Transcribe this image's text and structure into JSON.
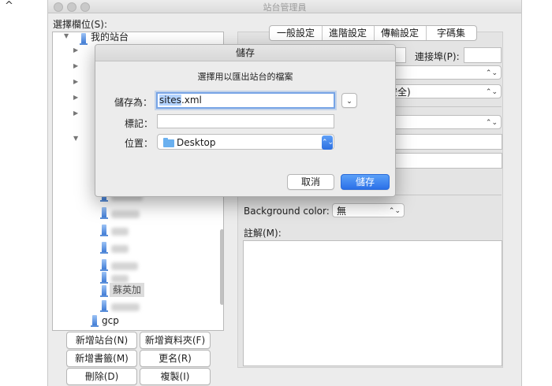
{
  "window": {
    "title": "站台管理員",
    "back_glyph": "^"
  },
  "left": {
    "select_entry_label": "選擇欄位(S):",
    "root_label": "我的站台",
    "visible_sites": [
      "蘇英加",
      "gcp"
    ],
    "buttons": {
      "new_site": "新增站台(N)",
      "new_folder": "新增資料夾(F)",
      "new_bookmark": "新增書籤(M)",
      "rename": "更名(R)",
      "delete": "刪除(D)",
      "duplicate": "複製(I)"
    }
  },
  "right": {
    "tabs": [
      "一般設定",
      "進階設定",
      "傳輸設定",
      "字碼集"
    ],
    "port_label": "連接埠(P):",
    "port_value": "",
    "encryption_fragment": "安全)",
    "background_color_label": "Background color:",
    "background_color_value": "無",
    "comments_label": "註解(M):",
    "comments_value": ""
  },
  "dialog": {
    "title": "儲存",
    "subtitle": "選擇用以匯出站台的檔案",
    "save_as_label": "儲存為：",
    "filename_selected": "sites",
    "filename_ext": ".xml",
    "tags_label": "標記：",
    "tags_value": "",
    "location_label": "位置：",
    "location_value": "Desktop",
    "cancel_label": "取消",
    "save_label": "儲存"
  },
  "icons": {
    "expand": "triangle-right-icon",
    "collapse": "triangle-down-icon",
    "updown": "updown-chevron-icon",
    "chevron_down": "chevron-down-icon",
    "folder": "folder-icon",
    "site": "site-icon"
  },
  "colors": {
    "accent": "#2b70e8",
    "selection": "#b3d3ff",
    "folder": "#6ab0ef"
  }
}
